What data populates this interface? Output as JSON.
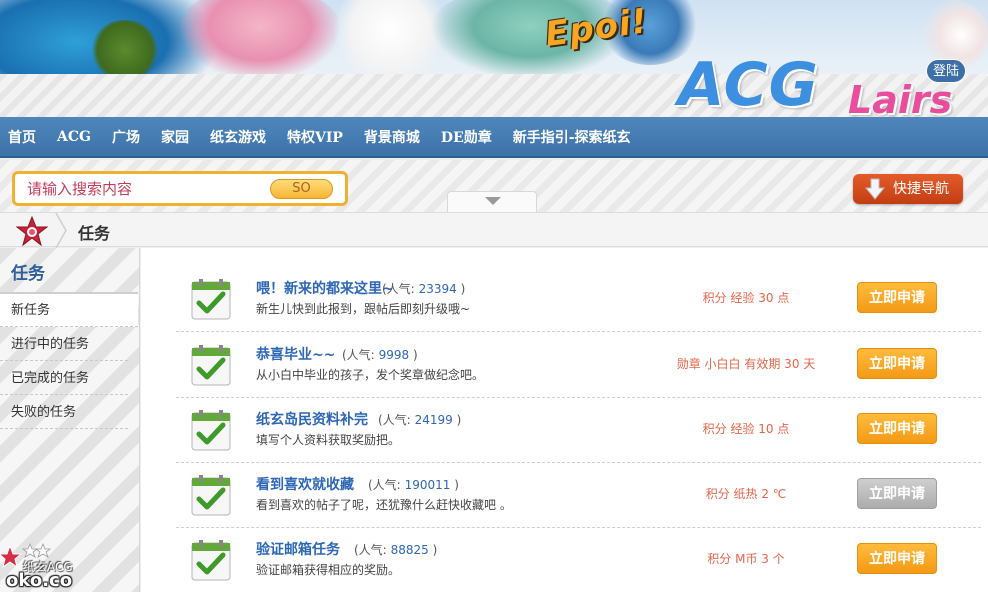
{
  "banner": {
    "headline": "Epoi!",
    "logo_main": "ACG",
    "logo_sub": "Lairs",
    "login_label": "登陆"
  },
  "nav": {
    "items": [
      {
        "label": "首页"
      },
      {
        "label": "ACG"
      },
      {
        "label": "广场"
      },
      {
        "label": "家园"
      },
      {
        "label": "纸玄游戏"
      },
      {
        "label": "特权VIP"
      },
      {
        "label": "背景商城"
      },
      {
        "label": "DE勋章"
      },
      {
        "label": "新手指引-探索纸玄"
      }
    ]
  },
  "search": {
    "placeholder": "请输入搜索内容",
    "button_label": "SO"
  },
  "quick_nav": {
    "label": "快捷导航",
    "icon": "down-arrow-icon"
  },
  "breadcrumb": {
    "home_icon": "home-star-icon",
    "current": "任务"
  },
  "sidebar": {
    "title": "任务",
    "items": [
      {
        "label": "新任务",
        "active": true
      },
      {
        "label": "进行中的任务",
        "active": false
      },
      {
        "label": "已完成的任务",
        "active": false
      },
      {
        "label": "失败的任务",
        "active": false
      }
    ]
  },
  "tasks": [
    {
      "title": "喂！新来的都来这里~",
      "popularity_label": "(人气:",
      "popularity": "23394",
      "popularity_close": ")",
      "description": "新生儿快到此报到，跟帖后即刻升级哦~",
      "reward": "积分 经验 30 点",
      "button_label": "立即申请",
      "enabled": true
    },
    {
      "title": "恭喜毕业~~",
      "popularity_label": "(人气:",
      "popularity": "9998",
      "popularity_close": ")",
      "description": "从小白中毕业的孩子，发个奖章做纪念吧。",
      "reward": "勋章 小白白 有效期 30 天",
      "button_label": "立即申请",
      "enabled": true
    },
    {
      "title": "纸玄岛民资料补完",
      "popularity_label": "(人气:",
      "popularity": "24199",
      "popularity_close": ")",
      "description": "填写个人资料获取奖励把。",
      "reward": "积分 经验 10 点",
      "button_label": "立即申请",
      "enabled": true
    },
    {
      "title": "看到喜欢就收藏",
      "popularity_label": "(人气:",
      "popularity": "190011",
      "popularity_close": ")",
      "description": "看到喜欢的帖子了呢，还犹豫什么赶快收藏吧 。",
      "reward": "积分 纸热 2 ℃",
      "button_label": "立即申请",
      "enabled": false
    },
    {
      "title": "验证邮箱任务",
      "popularity_label": "(人气:",
      "popularity": "88825",
      "popularity_close": ")",
      "description": "验证邮箱获得相应的奖励。",
      "reward": "积分 M币 3 个",
      "button_label": "立即申请",
      "enabled": true
    }
  ],
  "watermark": {
    "site_name": "纸玄ACG",
    "domain": "oko.co"
  },
  "colors": {
    "nav_bg": "#3c72a8",
    "accent_orange": "#f39a16",
    "link_blue": "#2d67b5",
    "reward_red": "#e4654a",
    "search_border": "#f2b02f"
  }
}
